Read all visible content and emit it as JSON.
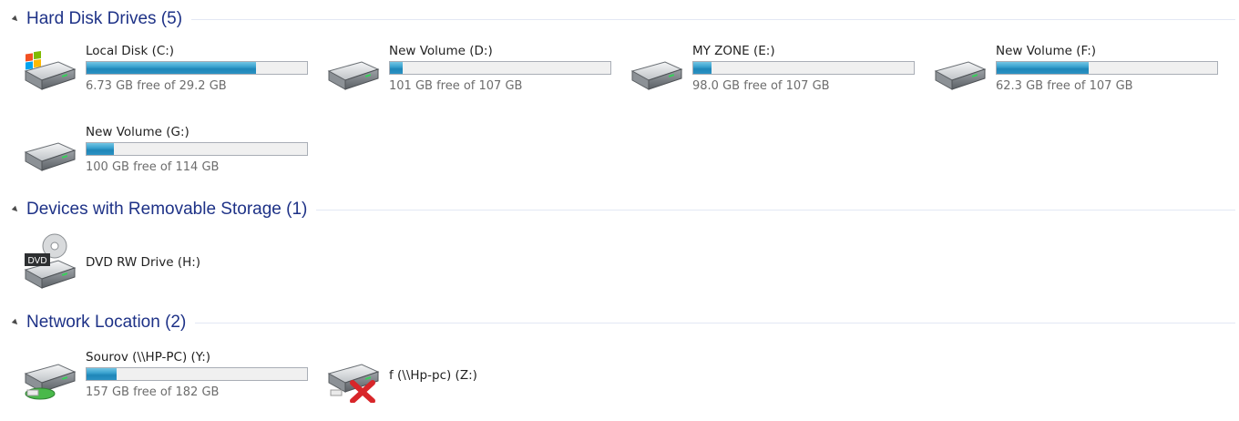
{
  "groups": {
    "hdd": {
      "title": "Hard Disk Drives (5)"
    },
    "removable": {
      "title": "Devices with Removable Storage (1)"
    },
    "network": {
      "title": "Network Location (2)"
    }
  },
  "drives": {
    "c": {
      "name": "Local Disk (C:)",
      "free_text": "6.73 GB free of 29.2 GB",
      "used_fraction": 0.77
    },
    "d": {
      "name": "New Volume (D:)",
      "free_text": "101 GB free of 107 GB",
      "used_fraction": 0.056
    },
    "e": {
      "name": "MY ZONE (E:)",
      "free_text": "98.0 GB free of 107 GB",
      "used_fraction": 0.084
    },
    "f": {
      "name": "New Volume (F:)",
      "free_text": "62.3 GB free of 107 GB",
      "used_fraction": 0.418
    },
    "g": {
      "name": "New Volume (G:)",
      "free_text": "100 GB free of 114 GB",
      "used_fraction": 0.123
    },
    "h": {
      "name": "DVD RW Drive (H:)",
      "icon_label": "DVD"
    },
    "y": {
      "name": "Sourov (\\\\HP-PC) (Y:)",
      "free_text": "157 GB free of 182 GB",
      "used_fraction": 0.137
    },
    "z": {
      "name": "f (\\\\Hp-pc) (Z:)"
    }
  },
  "icons": {
    "hdd": "hard-drive-icon",
    "system": "windows-drive-icon",
    "dvd": "dvd-drive-icon",
    "network": "network-drive-icon",
    "network_disconnected": "disconnected-network-drive-icon"
  },
  "colors": {
    "header_text": "#1e3287",
    "bar_fill": "#2b92c3",
    "free_text": "#6d6d6d"
  }
}
